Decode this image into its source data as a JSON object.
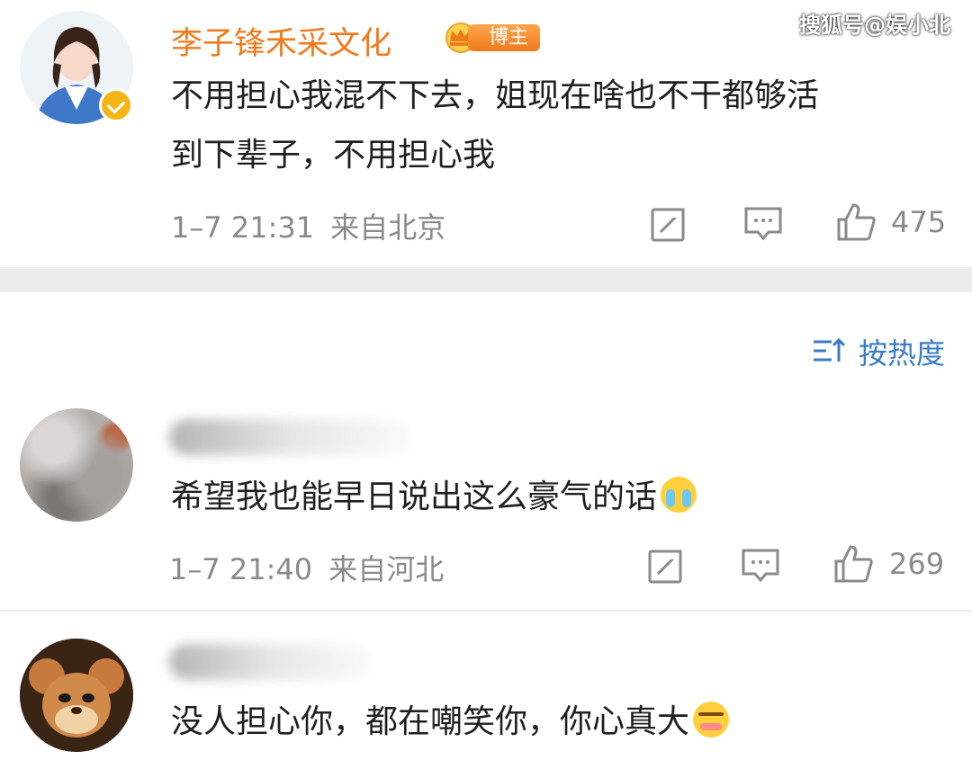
{
  "watermark": "搜狐号@娱小北",
  "sort": {
    "label": "按热度",
    "icon": "sort-icon"
  },
  "post": {
    "username": "李子锋禾采文化",
    "badge_label": "博主",
    "content_lines": [
      "不用担心我混不下去，姐现在啥也不干都够活",
      "到下辈子，不用担心我"
    ],
    "time": "1–7 21:31",
    "location": "来自北京",
    "likes": "475"
  },
  "comments": [
    {
      "text": "希望我也能早日说出这么豪气的话",
      "emoji": "crying-face-emoji",
      "time": "1–7 21:40",
      "location": "来自河北",
      "likes": "269"
    },
    {
      "text": "没人担心你，都在嘲笑你，你心真大",
      "emoji": "shy-face-emoji"
    }
  ],
  "colors": {
    "username": "#f07a1b",
    "sort_label": "#3a7bc8",
    "meta_gray": "#8a8a8a",
    "verified_badge": "#f5b515"
  }
}
